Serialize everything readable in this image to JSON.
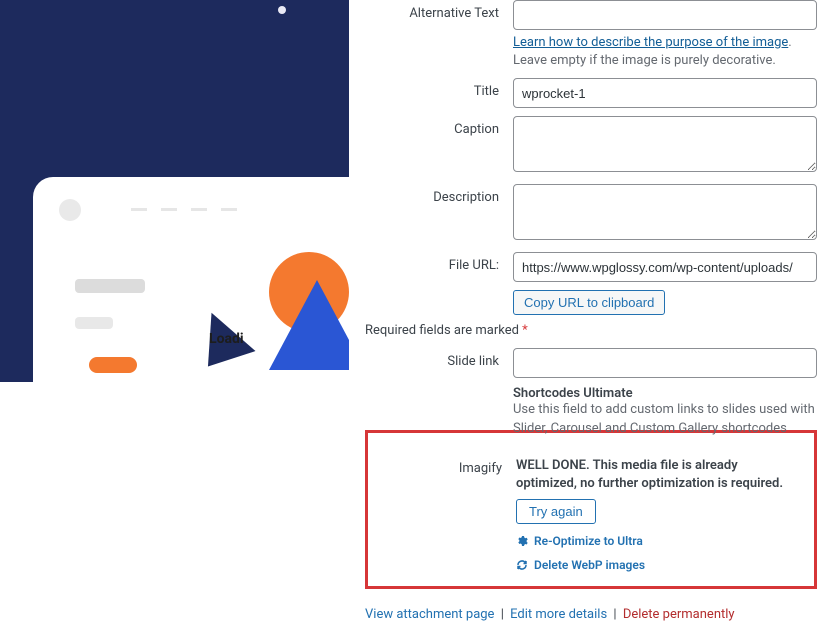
{
  "labels": {
    "alt": "Alternative Text",
    "title": "Title",
    "caption": "Caption",
    "description": "Description",
    "fileurl": "File URL:",
    "slidelink": "Slide link",
    "imagify": "Imagify"
  },
  "values": {
    "title": "wprocket-1",
    "fileurl": "https://www.wpglossy.com/wp-content/uploads/"
  },
  "helper": {
    "alt_link": "Learn how to describe the purpose of the image",
    "alt_rest": ". Leave empty if the image is purely decorative."
  },
  "buttons": {
    "copyurl": "Copy URL to clipboard",
    "tryagain": "Try again"
  },
  "required_note": "Required fields are marked ",
  "required_star": "*",
  "shortcode": {
    "title": "Shortcodes Ultimate",
    "desc": "Use this field to add custom links to slides used with Slider, Carousel and Custom Gallery shortcodes"
  },
  "imagify": {
    "msg": "WELL DONE. This media file is already optimized, no further optimization is required.",
    "reopt": "Re-Optimize to Ultra",
    "delwebp": "Delete WebP images"
  },
  "bottom": {
    "view": "View attachment page",
    "edit": "Edit more details",
    "delete": "Delete permanently"
  },
  "preview": {
    "loading": "Loadi"
  }
}
